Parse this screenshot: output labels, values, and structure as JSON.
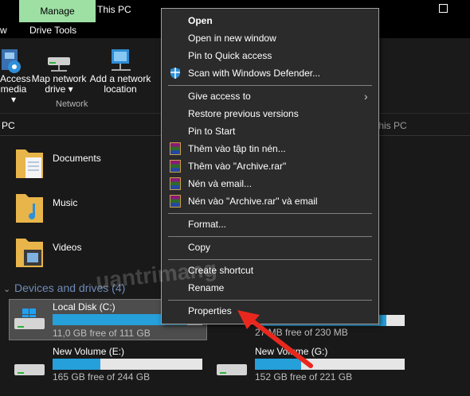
{
  "window": {
    "manage_tab": "Manage",
    "title": "This PC",
    "tabs": [
      "w",
      "Drive Tools"
    ]
  },
  "ribbon": {
    "access_media_line1": "Access",
    "access_media_line2": "media ▾",
    "map_network_line1": "Map network",
    "map_network_line2": "drive ▾",
    "add_network_line1": "Add a network",
    "add_network_line2": "location",
    "network_group": "Network"
  },
  "address": {
    "left": "PC",
    "right": "This PC"
  },
  "folders": [
    {
      "label": "Documents"
    },
    {
      "label": "Music"
    },
    {
      "label": "Videos"
    }
  ],
  "devices_header": "Devices and drives (4)",
  "drives": [
    {
      "name": "Local Disk (C:)",
      "free_text": "11,0 GB free of 111 GB",
      "used_fraction": 0.9
    },
    {
      "name": "",
      "free_text": "27 MB free of 230 MB",
      "used_fraction": 0.88
    },
    {
      "name": "New Volume (E:)",
      "free_text": "165 GB free of 244 GB",
      "used_fraction": 0.32
    },
    {
      "name": "New Volume (G:)",
      "free_text": "152 GB free of 221 GB",
      "used_fraction": 0.31
    }
  ],
  "context_menu": {
    "items": [
      {
        "label": "Open",
        "bold": true
      },
      {
        "label": "Open in new window"
      },
      {
        "label": "Pin to Quick access"
      },
      {
        "label": "Scan with Windows Defender...",
        "icon": "shield-icon"
      },
      {
        "label": "Give access to",
        "submenu": true
      },
      {
        "label": "Restore previous versions"
      },
      {
        "label": "Pin to Start"
      },
      {
        "label": "Thêm vào tập tin nén...",
        "icon": "winrar-icon"
      },
      {
        "label": "Thêm vào \"Archive.rar\"",
        "icon": "winrar-icon"
      },
      {
        "label": "Nén và email...",
        "icon": "winrar-icon"
      },
      {
        "label": "Nén vào \"Archive.rar\" và email",
        "icon": "winrar-icon"
      },
      {
        "label": "Format..."
      },
      {
        "label": "Copy"
      },
      {
        "label": "Create shortcut"
      },
      {
        "label": "Rename"
      },
      {
        "label": "Properties"
      }
    ]
  },
  "watermark": "uantrimang",
  "colors": {
    "accent": "#26a0da",
    "manage_tab": "#9ee0a4",
    "arrow": "#e8281e"
  }
}
